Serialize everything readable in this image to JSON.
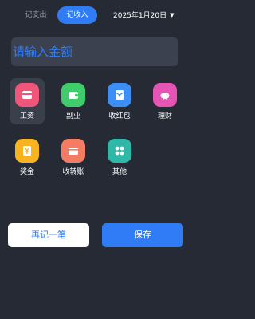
{
  "tabs": [
    {
      "label": "记支出",
      "active": false
    },
    {
      "label": "记收入",
      "active": true
    }
  ],
  "date": {
    "value": "2025年1月20日",
    "caret": "▼"
  },
  "amount": {
    "placeholder": "请输入金额",
    "value": ""
  },
  "categories": [
    {
      "label": "工资",
      "icon": "card-icon",
      "selected": true
    },
    {
      "label": "副业",
      "icon": "wallet-icon",
      "selected": false
    },
    {
      "label": "收红包",
      "icon": "red-packet-icon",
      "selected": false
    },
    {
      "label": "理财",
      "icon": "piggy-bank-icon",
      "selected": false
    },
    {
      "label": "奖金",
      "icon": "yuan-icon",
      "selected": false
    },
    {
      "label": "收转账",
      "icon": "transfer-card-icon",
      "selected": false
    },
    {
      "label": "其他",
      "icon": "grid-icon",
      "selected": false
    }
  ],
  "buttons": {
    "again": "再记一笔",
    "save": "保存"
  },
  "colors": {
    "background": "#262a35",
    "accent": "#2f7cf6",
    "input_bg": "#3b414f",
    "salary": "#f0567a",
    "side_job": "#3fcc6a",
    "red_packet": "#3d8ff5",
    "finance": "#e455b4",
    "bonus": "#f7b320",
    "transfer": "#f47c62",
    "other": "#2fb8a7"
  }
}
